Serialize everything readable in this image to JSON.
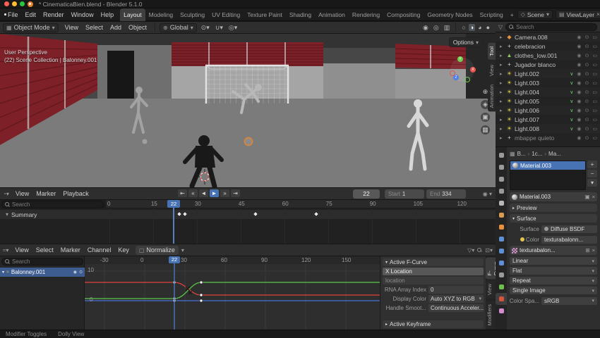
{
  "window": {
    "title": "* CinematicaBien.blend - Blender 5.1.0"
  },
  "topbar": {
    "menus": [
      "File",
      "Edit",
      "Render",
      "Window",
      "Help"
    ],
    "workspaces": [
      "Layout",
      "Modeling",
      "Sculpting",
      "UV Editing",
      "Texture Paint",
      "Shading",
      "Animation",
      "Rendering",
      "Compositing",
      "Geometry Nodes",
      "Scripting",
      "+"
    ],
    "active_workspace": "Layout",
    "scene_label": "Scene",
    "viewlayer_label": "ViewLayer"
  },
  "viewport": {
    "header": {
      "mode": "Object Mode",
      "menus": [
        "View",
        "Select",
        "Add",
        "Object"
      ],
      "orientation": "Global",
      "options_label": "Options",
      "tool_icons": [
        {
          "name": "transform-pivot",
          "glyph": "⊙"
        },
        {
          "name": "snap-magnet",
          "glyph": "∪"
        },
        {
          "name": "proportional-edit",
          "glyph": "◎"
        }
      ],
      "overlay_icons": [
        {
          "name": "show-gizmos",
          "glyph": "◉"
        },
        {
          "name": "show-overlays",
          "glyph": "◎"
        },
        {
          "name": "toggle-xray",
          "glyph": "▥"
        }
      ],
      "shading_modes": [
        {
          "name": "wireframe",
          "glyph": "○"
        },
        {
          "name": "solid",
          "glyph": "◑"
        },
        {
          "name": "material-preview",
          "glyph": "◕"
        },
        {
          "name": "rendered",
          "glyph": "●"
        }
      ],
      "shading_active": 1
    },
    "overlay": {
      "line1": "User Perspective",
      "line2": "(22) Scene Collection | Balonney.001"
    },
    "gizmo_tools": [
      {
        "name": "zoom",
        "glyph": "⊕"
      },
      {
        "name": "pan-hand",
        "glyph": "◈"
      },
      {
        "name": "camera-view",
        "glyph": "▣"
      },
      {
        "name": "toggle-ortho",
        "glyph": "▦"
      }
    ],
    "sidebar_tabs": [
      "Tool",
      "View",
      "Animation"
    ]
  },
  "outliner": {
    "search_placeholder": "Search",
    "items": [
      {
        "name": "Camera.008",
        "type": "camera"
      },
      {
        "name": "celebracion",
        "type": "armature"
      },
      {
        "name": "clothes_low.001",
        "type": "mesh"
      },
      {
        "name": "Jugador blanco",
        "type": "armature"
      },
      {
        "name": "Light.002",
        "type": "light"
      },
      {
        "name": "Light.003",
        "type": "light"
      },
      {
        "name": "Light.004",
        "type": "light"
      },
      {
        "name": "Light.005",
        "type": "light"
      },
      {
        "name": "Light.006",
        "type": "light"
      },
      {
        "name": "Light.007",
        "type": "light"
      },
      {
        "name": "Light.008",
        "type": "light"
      },
      {
        "name": "mbappe quieto",
        "type": "armature",
        "dim": true
      }
    ]
  },
  "properties": {
    "tab_icons": [
      {
        "name": "tool",
        "color": "#9a9a9a"
      },
      {
        "name": "render",
        "color": "#9a9a9a"
      },
      {
        "name": "output",
        "color": "#9a9a9a"
      },
      {
        "name": "view-layer",
        "color": "#9a9a9a"
      },
      {
        "name": "scene",
        "color": "#b8b8b8"
      },
      {
        "name": "world",
        "color": "#d99a52"
      },
      {
        "name": "object",
        "color": "#e8913c"
      },
      {
        "name": "modifiers",
        "color": "#5f8fd4"
      },
      {
        "name": "particles",
        "color": "#5f8fd4"
      },
      {
        "name": "physics",
        "color": "#5f8fd4"
      },
      {
        "name": "constraints",
        "color": "#9a9a9a"
      },
      {
        "name": "data",
        "color": "#6fbf4f"
      },
      {
        "name": "material",
        "color": "#d4543e",
        "active": true
      },
      {
        "name": "texture",
        "color": "#d48ccf"
      }
    ],
    "breadcrumb": [
      "B...",
      "1c...",
      "Ma..."
    ],
    "slot_name": "Material.003",
    "material_name": "Material.003",
    "preview_label": "Preview",
    "surface_header": "Surface",
    "surface_label": "Surface",
    "surface_value": "Diffuse BSDF",
    "color_label": "Color",
    "color_value": "texturabalonn...",
    "texture_name": "texturabalon...",
    "interp": "Linear",
    "projection": "Flat",
    "extension": "Repeat",
    "source": "Single Image",
    "colorspace_label": "Color Spa...",
    "colorspace": "sRGB"
  },
  "timeline": {
    "menus": [
      "View",
      "Marker",
      "Playback"
    ],
    "playback_buttons": [
      {
        "name": "jump-to-start",
        "glyph": "⇤"
      },
      {
        "name": "prev-keyframe",
        "glyph": "«"
      },
      {
        "name": "play-reverse",
        "glyph": "◄"
      },
      {
        "name": "play",
        "glyph": "►"
      },
      {
        "name": "next-keyframe",
        "glyph": "»"
      },
      {
        "name": "jump-to-end",
        "glyph": "⇥"
      }
    ],
    "current_frame": "22",
    "start_label": "Start",
    "start": "1",
    "end_label": "End",
    "end": "334",
    "ruler": [
      0,
      15,
      30,
      45,
      60,
      75,
      90,
      105,
      120
    ],
    "keyframe_frames": [
      24,
      26,
      50,
      71
    ],
    "search_placeholder": "Search",
    "summary_label": "Summary"
  },
  "graph": {
    "menus": [
      "View",
      "Select",
      "Marker",
      "Channel",
      "Key"
    ],
    "normalize_label": "Normalize",
    "search_placeholder": "Search",
    "channel": "Balonney.001",
    "ruler": [
      -30,
      0,
      30,
      60,
      90,
      120,
      150
    ],
    "y_labels": [
      "10",
      "0"
    ],
    "playhead": "22",
    "sidebar": {
      "panel1": "Active F-Curve",
      "name_value": "X Location",
      "rna_path": "location",
      "rna_index_label": "RNA Array Index",
      "rna_index": "0",
      "display_color_label": "Display Color",
      "display_color": "Auto XYZ to RGB",
      "handle_label": "Handle Smoot...",
      "handle": "Continuous Acceler...",
      "panel2": "Active Keyframe"
    },
    "tabs": [
      "F-Curve",
      "View",
      "Modifiers"
    ]
  },
  "statusbar": {
    "hints": [
      "Modifier Toggles",
      "Dolly View"
    ]
  }
}
